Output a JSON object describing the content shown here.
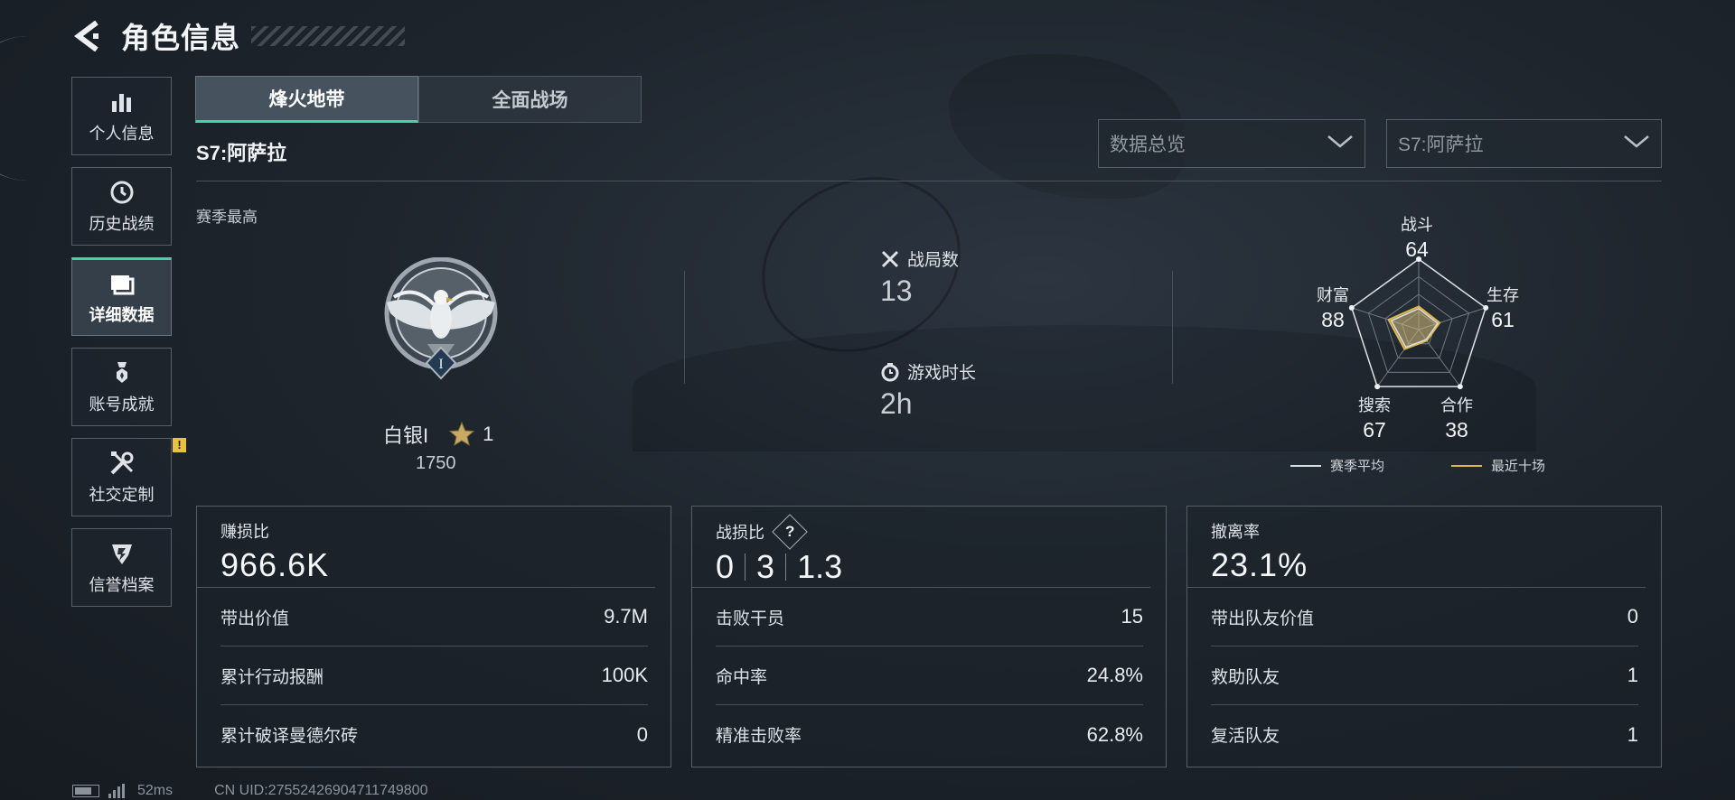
{
  "header": {
    "title": "角色信息"
  },
  "sidebar": {
    "items": [
      {
        "label": "个人信息",
        "icon": "bar-chart-icon",
        "active": false
      },
      {
        "label": "历史战绩",
        "icon": "history-clock-icon",
        "active": false
      },
      {
        "label": "详细数据",
        "icon": "folder-icon",
        "active": true
      },
      {
        "label": "账号成就",
        "icon": "achievement-medal-icon",
        "active": false
      },
      {
        "label": "社交定制",
        "icon": "tools-icon",
        "active": false,
        "badge": "!"
      },
      {
        "label": "信誉档案",
        "icon": "shield-emblem-icon",
        "active": false
      }
    ]
  },
  "tabs": [
    {
      "label": "烽火地带",
      "active": true
    },
    {
      "label": "全面战场",
      "active": false
    }
  ],
  "season": {
    "title": "S7:阿萨拉",
    "best_label": "赛季最高"
  },
  "filters": {
    "view": "数据总览",
    "season": "S7:阿萨拉"
  },
  "rank": {
    "name": "白银I",
    "stars": "1",
    "score": "1750"
  },
  "stats": {
    "matches_label": "战局数",
    "matches_value": "13",
    "playtime_label": "游戏时长",
    "playtime_value": "2h"
  },
  "radar": {
    "axes": [
      {
        "label": "战斗",
        "value": "64"
      },
      {
        "label": "生存",
        "value": "61"
      },
      {
        "label": "合作",
        "value": "38"
      },
      {
        "label": "搜索",
        "value": "67"
      },
      {
        "label": "财富",
        "value": "88"
      }
    ],
    "legend": {
      "season_avg": "赛季平均",
      "recent": "最近十场"
    },
    "colors": {
      "season_avg": "#d8dde2",
      "recent": "#e0b84a"
    }
  },
  "panels": {
    "profit": {
      "title": "赚损比",
      "value": "966.6K",
      "rows": [
        {
          "label": "带出价值",
          "value": "9.7M"
        },
        {
          "label": "累计行动报酬",
          "value": "100K"
        },
        {
          "label": "累计破译曼德尔砖",
          "value": "0"
        }
      ]
    },
    "kd": {
      "title": "战损比",
      "help": "?",
      "kills": "0",
      "deaths": "3",
      "ratio": "1.3",
      "rows": [
        {
          "label": "击败干员",
          "value": "15"
        },
        {
          "label": "命中率",
          "value": "24.8%"
        },
        {
          "label": "精准击败率",
          "value": "62.8%"
        }
      ]
    },
    "extract": {
      "title": "撤离率",
      "value": "23.1%",
      "rows": [
        {
          "label": "带出队友价值",
          "value": "0"
        },
        {
          "label": "救助队友",
          "value": "1"
        },
        {
          "label": "复活队友",
          "value": "1"
        }
      ]
    }
  },
  "footer": {
    "ping": "52ms",
    "uid": "CN UID:27552426904711749800"
  },
  "colors": {
    "accent": "#42d3a7",
    "badge": "#e8c240"
  }
}
